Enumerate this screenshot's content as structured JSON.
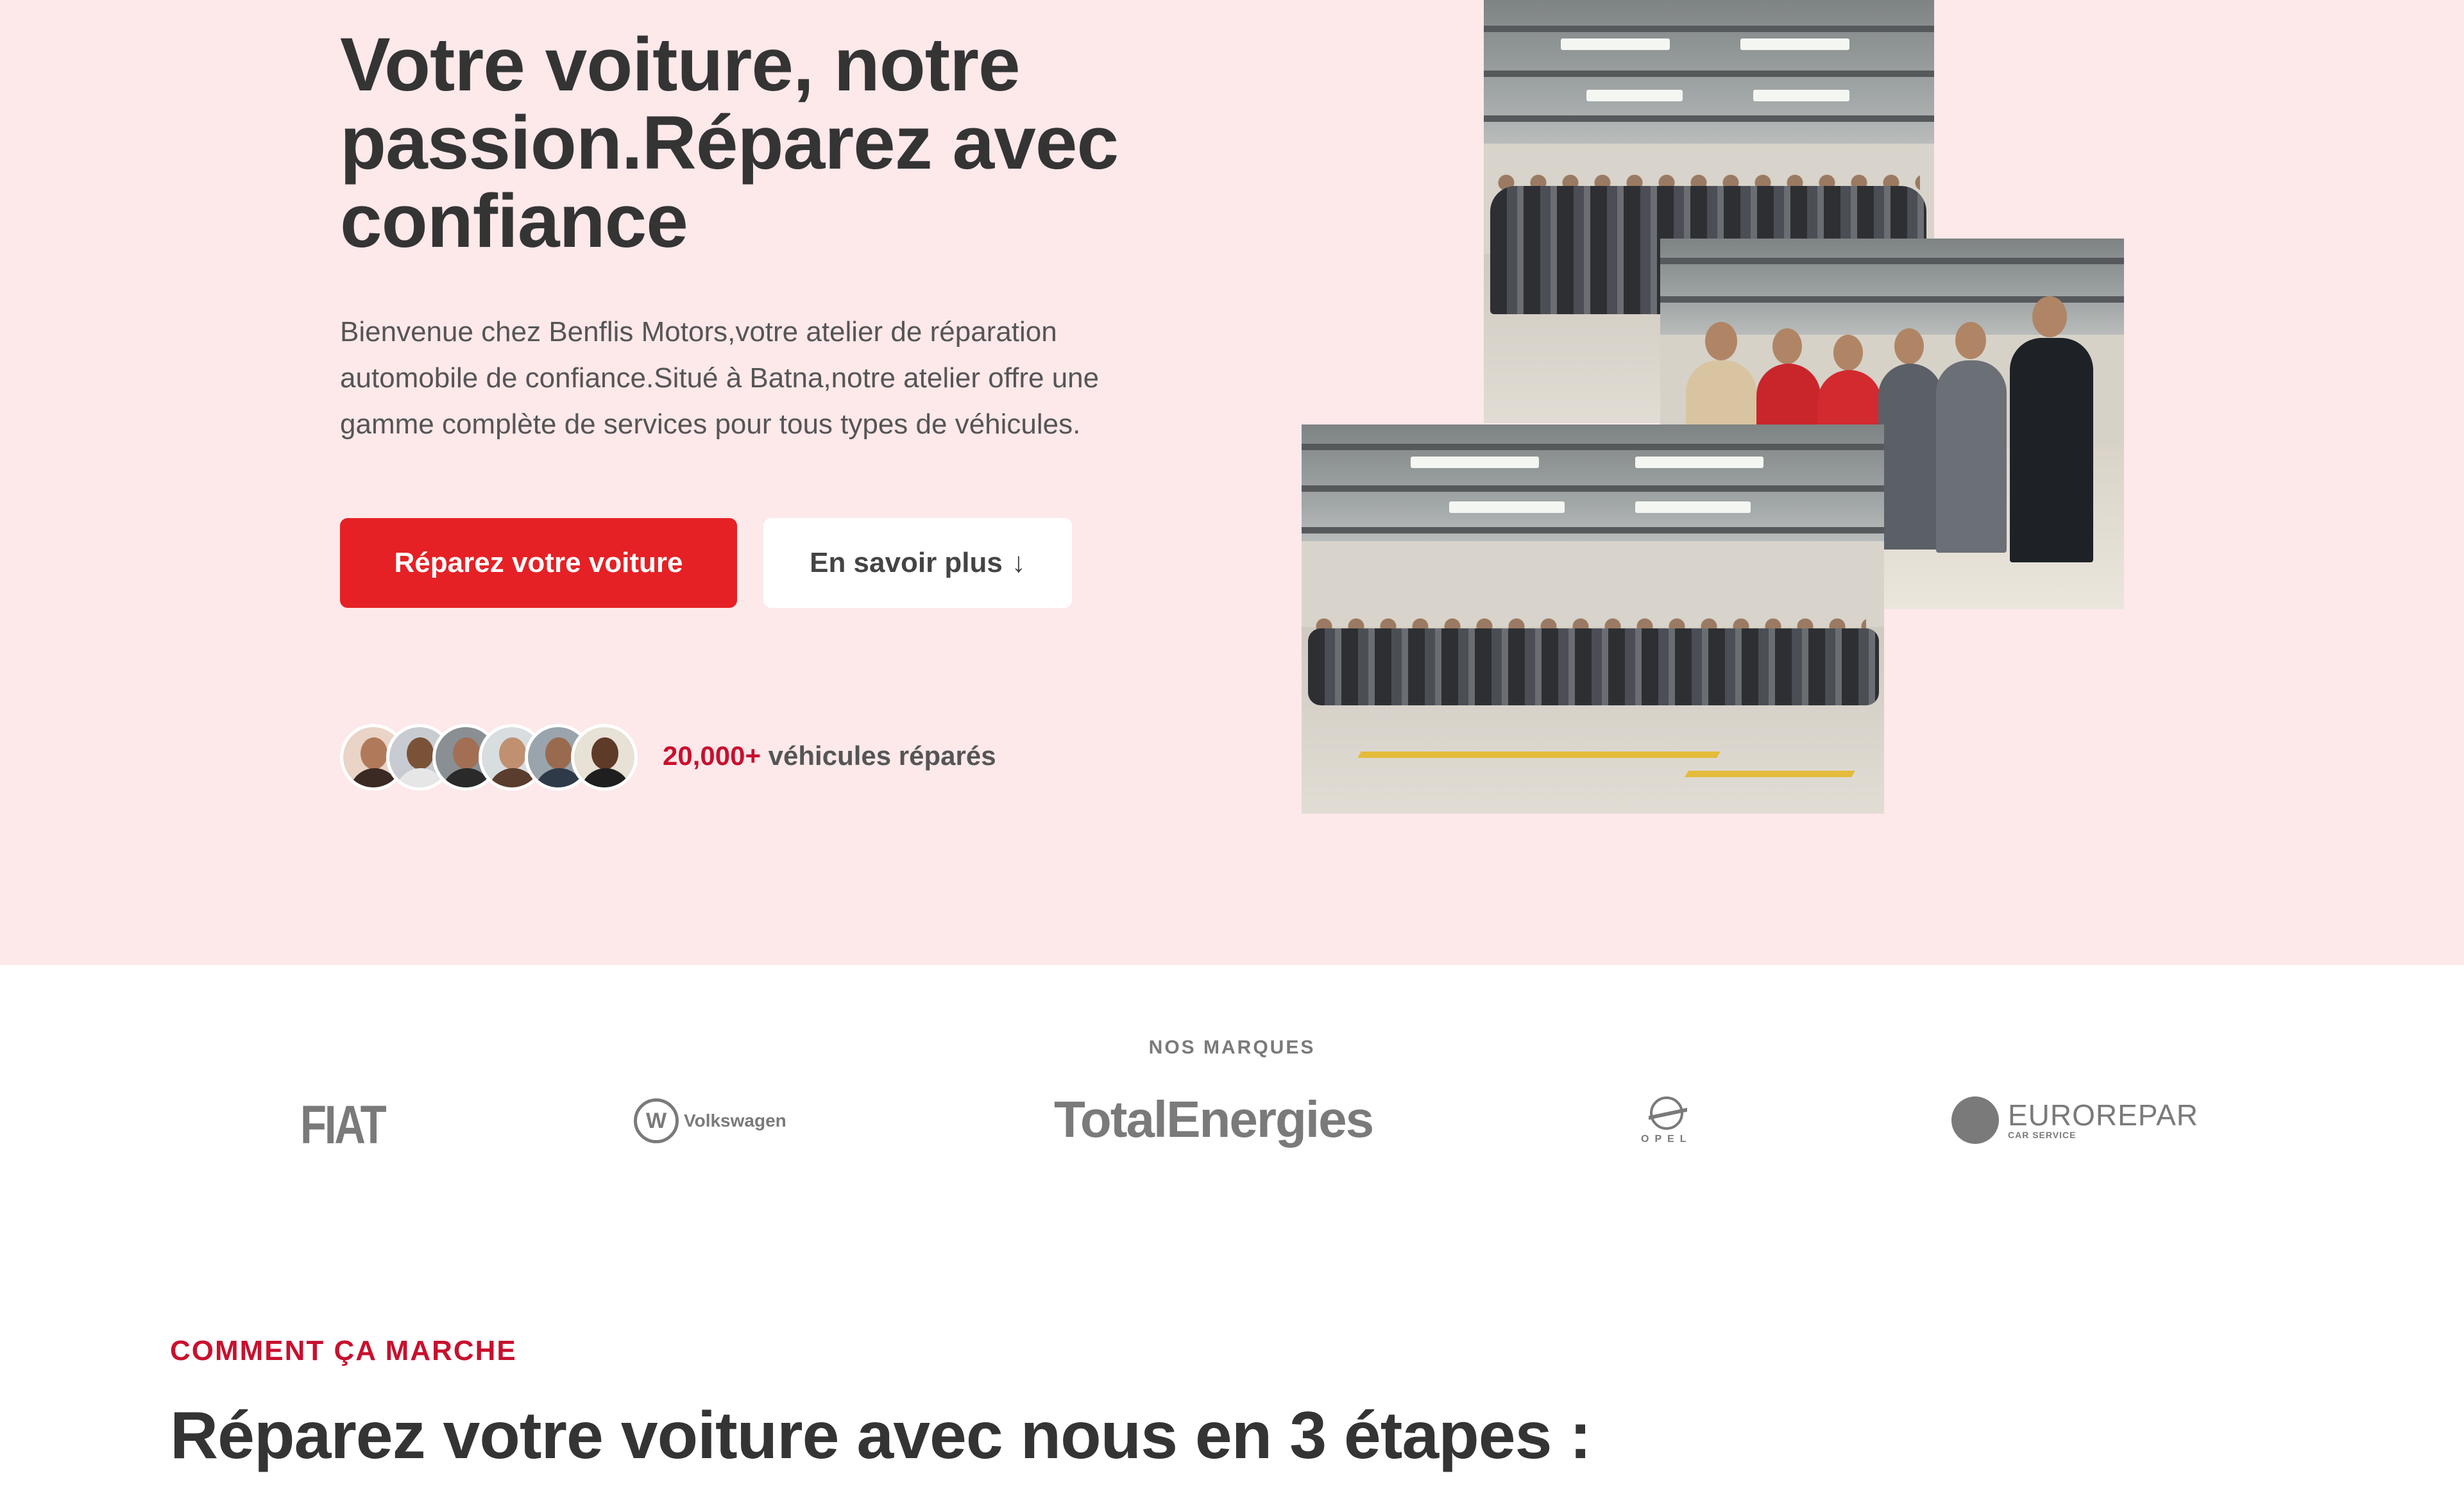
{
  "hero": {
    "title": "Votre voiture, notre passion.Réparez avec confiance",
    "description": "Bienvenue chez Benflis Motors,votre atelier de réparation automobile de confiance.Situé à Batna,notre atelier offre une gamme complète de services pour tous types de véhicules.",
    "primary_button": "Réparez votre voiture",
    "secondary_button": "En savoir plus",
    "secondary_button_icon": "↓",
    "counter_number": "20,000+",
    "counter_text": "véhicules réparés",
    "background_color": "#fde8ea",
    "accent_color": "#e52125"
  },
  "brands": {
    "label": "NOS MARQUES",
    "fiat": "FIAT",
    "volkswagen_mark": "W",
    "volkswagen": "Volkswagen",
    "totalenergies": "TotalEnergies",
    "opel": "OPEL",
    "eurorepar": "EUROREPAR",
    "eurorepar_sub": "CAR SERVICE"
  },
  "how_it_works": {
    "label": "COMMENT ÇA MARCHE",
    "title": "Réparez votre voiture avec nous en 3 étapes :"
  }
}
